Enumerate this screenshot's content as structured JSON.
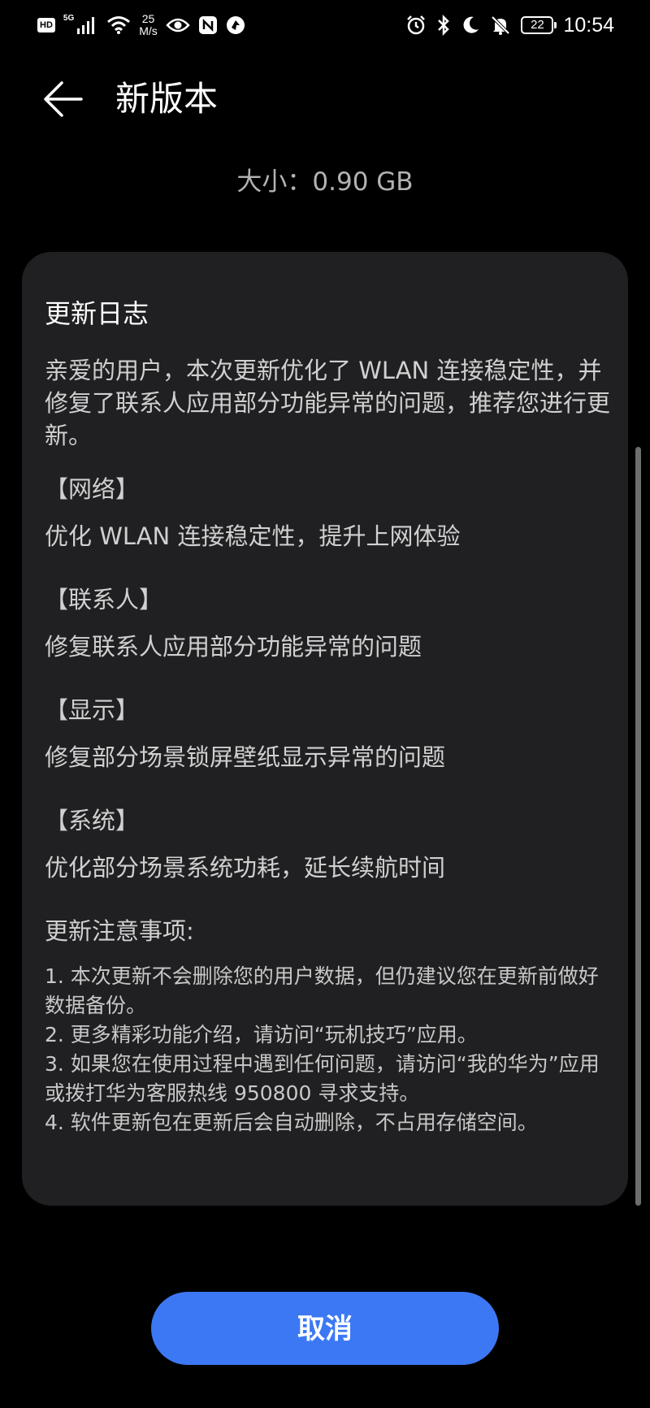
{
  "status_bar": {
    "hd": "HD",
    "network_type": "5G",
    "speed_value": "25",
    "speed_unit": "M/s",
    "battery": "22",
    "time": "10:54",
    "icons_left": [
      "hd-icon",
      "signal-icon",
      "wifi-icon",
      "eye-icon",
      "nfc-icon",
      "app-icon"
    ],
    "icons_right": [
      "alarm-icon",
      "bluetooth-icon",
      "moon-icon",
      "bell-off-icon",
      "battery-icon"
    ]
  },
  "header": {
    "title": "新版本"
  },
  "size": {
    "label": "大小：0.90 GB"
  },
  "changelog": {
    "title": "更新日志",
    "intro": "亲爱的用户，本次更新优化了 WLAN 连接稳定性，并修复了联系人应用部分功能异常的问题，推荐您进行更新。",
    "sections": [
      {
        "heading": "【网络】",
        "text": "优化 WLAN 连接稳定性，提升上网体验"
      },
      {
        "heading": "【联系人】",
        "text": "修复联系人应用部分功能异常的问题"
      },
      {
        "heading": "【显示】",
        "text": "修复部分场景锁屏壁纸显示异常的问题"
      },
      {
        "heading": "【系统】",
        "text": "优化部分场景系统功耗，延长续航时间"
      }
    ],
    "notes_title": "更新注意事项:",
    "notes": [
      "1. 本次更新不会删除您的用户数据，但仍建议您在更新前做好数据备份。",
      "2. 更多精彩功能介绍，请访问“玩机技巧”应用。",
      "3. 如果您在使用过程中遇到任何问题，请访问“我的华为”应用或拨打华为客服热线 950800 寻求支持。",
      "4. 软件更新包在更新后会自动删除，不占用存储空间。"
    ]
  },
  "cancel_label": "取消",
  "colors": {
    "background": "#000000",
    "card": "#202022",
    "accent": "#3c78f4"
  }
}
